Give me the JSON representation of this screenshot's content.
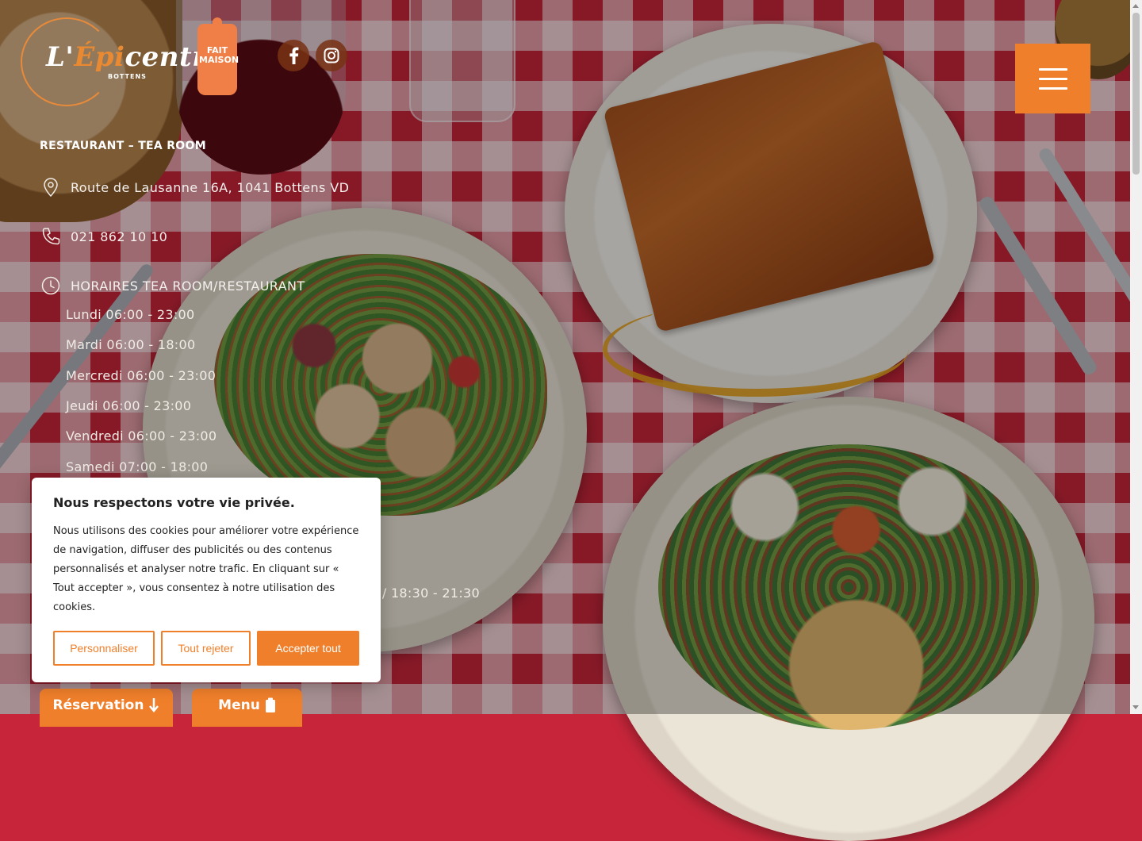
{
  "brand": {
    "logo_main": "L'Épicentre",
    "logo_sub": "BOTTENS",
    "badge_text": "FAIT MAISON",
    "accent_color": "#ef7f2b"
  },
  "social": {
    "facebook_icon": "facebook-icon",
    "instagram_icon": "instagram-icon"
  },
  "menu_toggle": {
    "icon": "hamburger-icon"
  },
  "info": {
    "tagline": "RESTAURANT – TEA ROOM",
    "address": "Route de Lausanne 16A, 1041 Bottens VD",
    "phone": "021 862 10 10",
    "hours_title": "HORAIRES TEA ROOM/RESTAURANT",
    "hours": [
      "Lundi 06:00 - 23:00",
      "Mardi 06:00 - 18:00",
      "Mercredi 06:00 - 23:00",
      "Jeudi 06:00 - 23:00",
      "Vendredi 06:00 - 23:00",
      "Samedi 07:00 - 18:00"
    ],
    "partial_hours": "0 / 18:30 - 21:30"
  },
  "cta": {
    "reservation": "Réservation",
    "menu": "Menu"
  },
  "cookie": {
    "title": "Nous respectons votre vie privée.",
    "body": "Nous utilisons des cookies pour améliorer votre expérience de navigation, diffuser des publicités ou des contenus personnalisés et analyser notre trafic. En cliquant sur « Tout accepter », vous consentez à notre utilisation des cookies.",
    "btn_customize": "Personnaliser",
    "btn_reject": "Tout rejeter",
    "btn_accept": "Accepter tout"
  }
}
